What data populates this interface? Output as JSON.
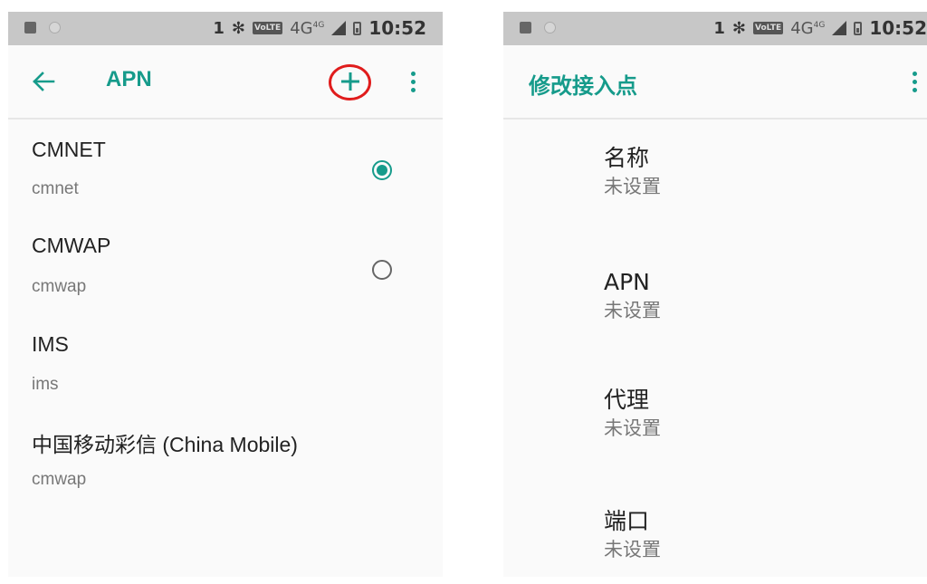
{
  "status_bar": {
    "sim_label": "1",
    "bluetooth": "✻",
    "volte": "VoLTE",
    "network": "4G",
    "network_sup": "4G",
    "time": "10:52"
  },
  "apn_screen": {
    "title": "APN",
    "back_icon": "arrow-left",
    "add_icon": "plus",
    "more_icon": "vertical-dots",
    "accent_color": "#169b8b",
    "highlight_color": "#e01c1c",
    "items": [
      {
        "name": "CMNET",
        "apn": "cmnet",
        "radio": "checked"
      },
      {
        "name": "CMWAP",
        "apn": "cmwap",
        "radio": "unchecked"
      },
      {
        "name": "IMS",
        "apn": "ims"
      },
      {
        "name": "中国移动彩信 (China Mobile)",
        "apn": "cmwap"
      }
    ]
  },
  "edit_screen": {
    "title": "修改接入点",
    "more_icon": "vertical-dots",
    "fields": [
      {
        "label": "名称",
        "value": "未设置"
      },
      {
        "label": "APN",
        "value": "未设置"
      },
      {
        "label": "代理",
        "value": "未设置"
      },
      {
        "label": "端口",
        "value": "未设置"
      }
    ]
  }
}
